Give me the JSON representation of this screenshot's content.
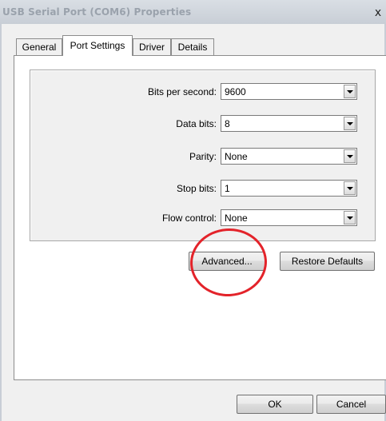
{
  "window": {
    "title": "USB Serial Port (COM6) Properties",
    "close_glyph": "x"
  },
  "tabs": [
    {
      "label": "General",
      "active": false
    },
    {
      "label": "Port Settings",
      "active": true
    },
    {
      "label": "Driver",
      "active": false
    },
    {
      "label": "Details",
      "active": false
    }
  ],
  "port_settings": {
    "bits_per_second": {
      "label": "Bits per second:",
      "value": "9600"
    },
    "data_bits": {
      "label": "Data bits:",
      "value": "8"
    },
    "parity": {
      "label": "Parity:",
      "value": "None"
    },
    "stop_bits": {
      "label": "Stop bits:",
      "value": "1"
    },
    "flow_control": {
      "label": "Flow control:",
      "value": "None"
    }
  },
  "buttons": {
    "advanced": "Advanced...",
    "restore_defaults": "Restore Defaults",
    "ok": "OK",
    "cancel": "Cancel"
  },
  "annotation": {
    "color": "#e3232a",
    "shape": "circle",
    "target": "advanced-button"
  },
  "colors": {
    "title_bar": "#c8ced6",
    "dialog_bg": "#f0f0f0",
    "tab_page_bg": "#ffffff"
  }
}
